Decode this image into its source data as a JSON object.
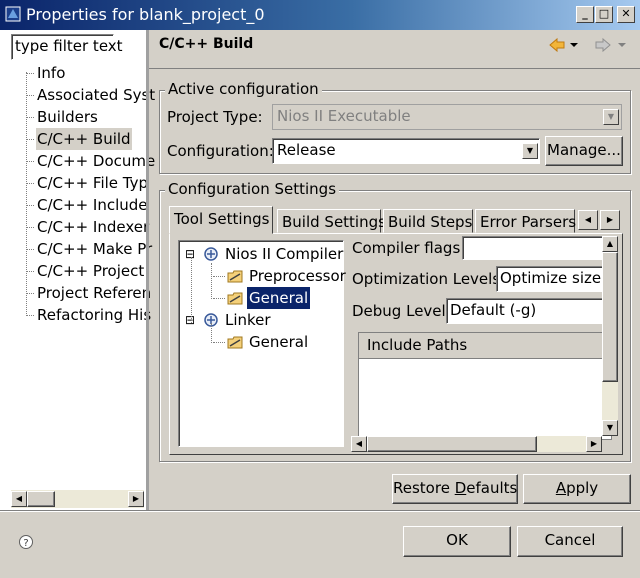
{
  "window": {
    "title": "Properties for blank_project_0",
    "buttons": {
      "minimize": "_",
      "maximize": "□",
      "close": "✕"
    }
  },
  "left_panel": {
    "filter_placeholder": "type filter text",
    "items": [
      {
        "label": "Info"
      },
      {
        "label": "Associated Syst"
      },
      {
        "label": "Builders"
      },
      {
        "label": "C/C++ Build",
        "selected": true
      },
      {
        "label": "C/C++ Docume"
      },
      {
        "label": "C/C++ File Typ"
      },
      {
        "label": "C/C++ Include"
      },
      {
        "label": "C/C++ Indexer"
      },
      {
        "label": "C/C++ Make Pr"
      },
      {
        "label": "C/C++ Project"
      },
      {
        "label": "Project Referen"
      },
      {
        "label": "Refactoring His"
      }
    ]
  },
  "header": {
    "title": "C/C++ Build",
    "nav": {
      "back_icon": "back-arrow-icon",
      "forward_icon": "forward-arrow-icon"
    }
  },
  "active_config": {
    "group_title": "Active configuration",
    "project_type_label": "Project Type:",
    "project_type_value": "Nios II Executable",
    "configuration_label": "Configuration:",
    "configuration_value": "Release",
    "manage_button": "Manage..."
  },
  "config_settings": {
    "group_title": "Configuration Settings",
    "tabs": [
      "Tool Settings",
      "Build Settings",
      "Build Steps",
      "Error Parsers"
    ],
    "tree": [
      {
        "label": "Nios II Compiler",
        "level": 0,
        "expander": "⊟"
      },
      {
        "label": "Preprocessor",
        "level": 1
      },
      {
        "label": "General",
        "level": 1,
        "selected": true
      },
      {
        "label": "Linker",
        "level": 0,
        "expander": "⊟"
      },
      {
        "label": "General",
        "level": 1
      }
    ],
    "compiler_flags_label": "Compiler flags",
    "compiler_flags_value": "",
    "optimization_label": "Optimization Levels",
    "optimization_value": "Optimize size (",
    "debug_label": "Debug Level",
    "debug_value": "Default (-g)",
    "include_paths_header": "Include Paths"
  },
  "footer": {
    "restore_defaults_prefix": "Restore ",
    "restore_defaults_mnemonic": "D",
    "restore_defaults_suffix": "efaults",
    "apply_prefix": "",
    "apply_mnemonic": "A",
    "apply_suffix": "pply",
    "ok": "OK",
    "cancel": "Cancel",
    "help_icon": "help-icon"
  }
}
